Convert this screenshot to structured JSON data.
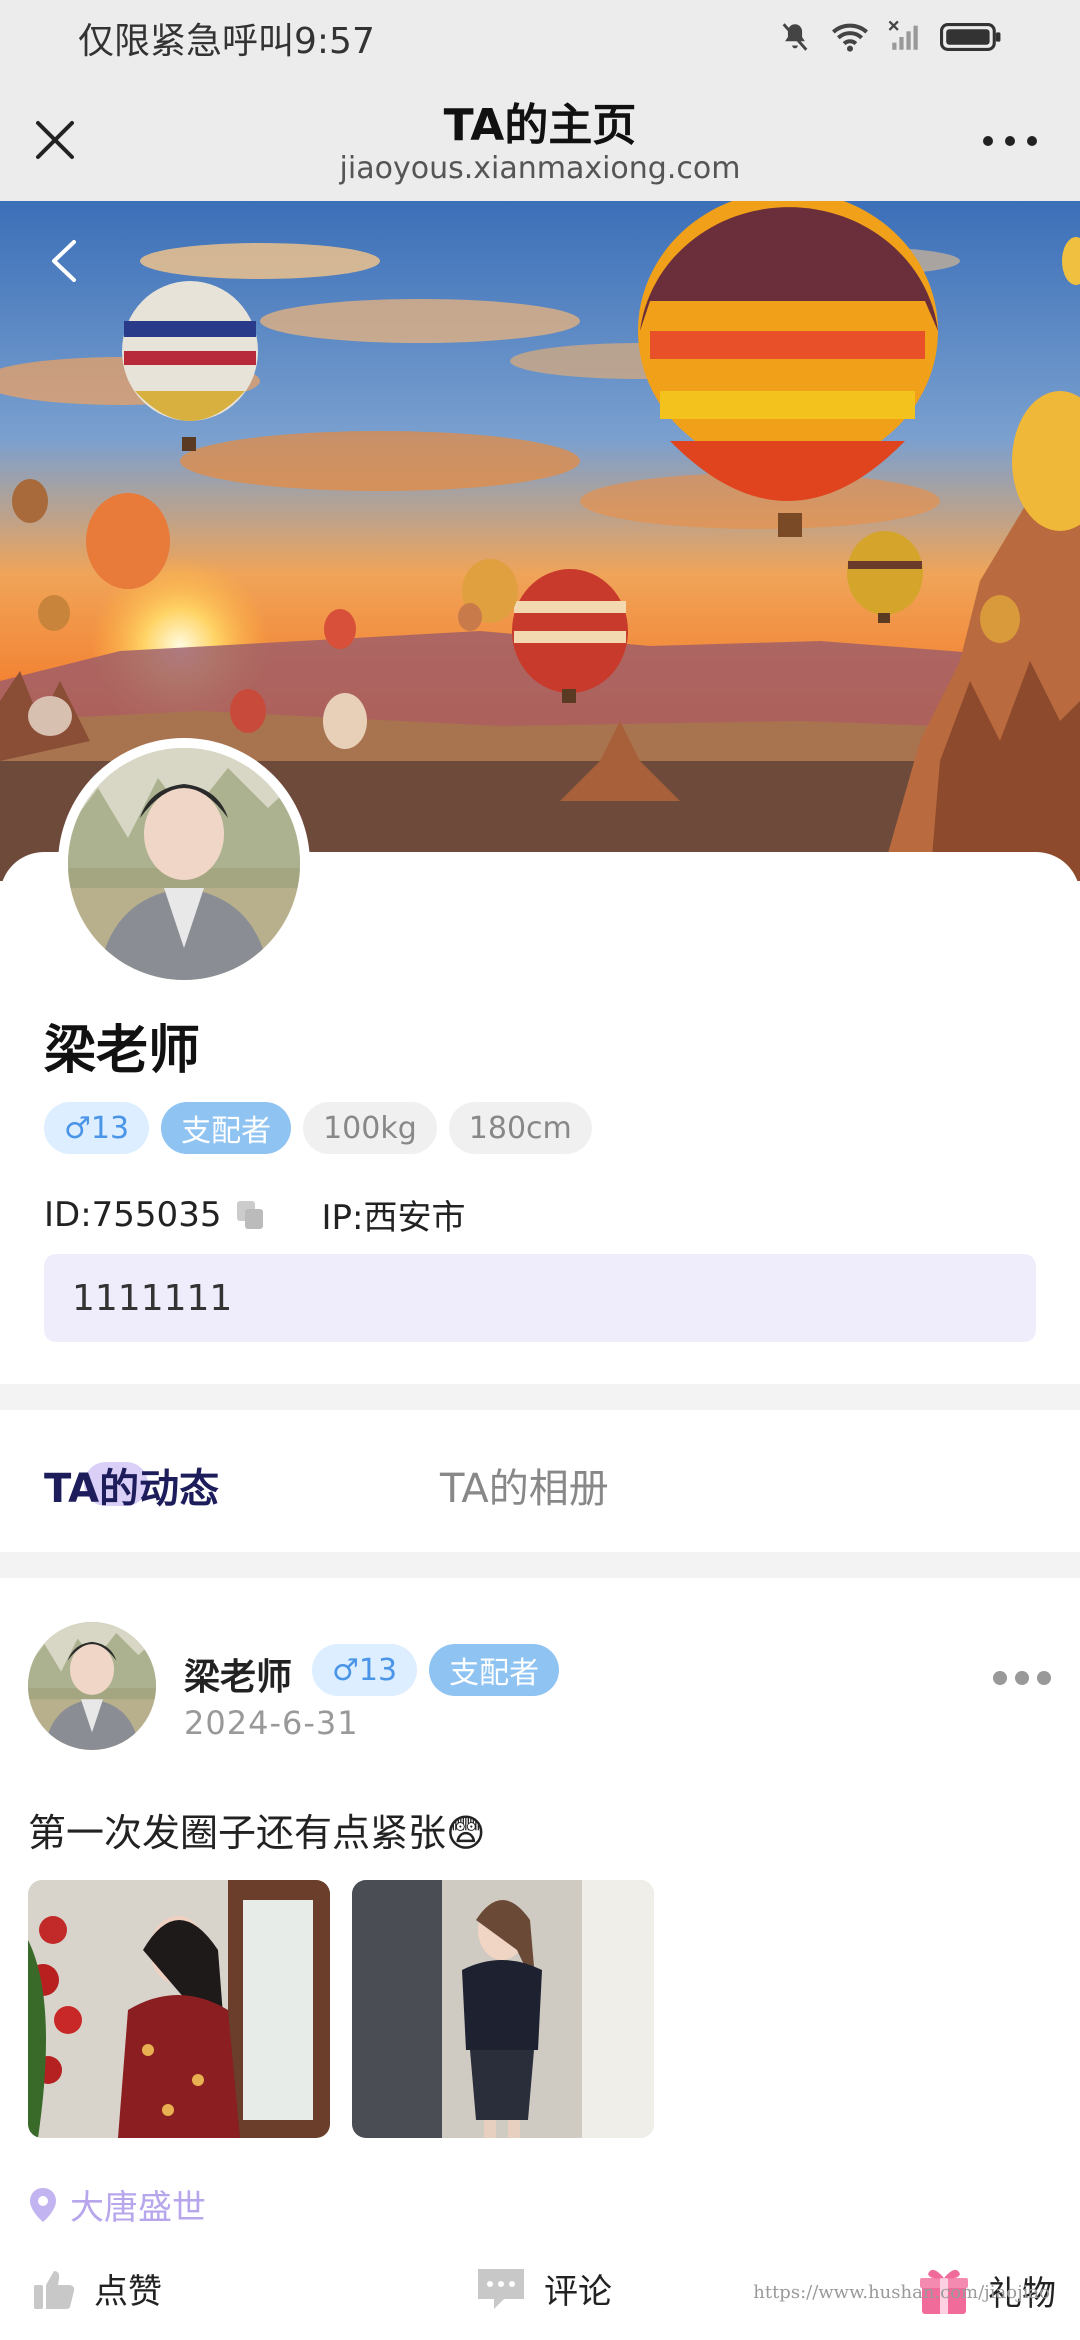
{
  "status_bar": {
    "carrier_time": "仅限紧急呼叫9:57"
  },
  "title_bar": {
    "title": "TA的主页",
    "url": "jiaoyous.xianmaxiong.com"
  },
  "profile": {
    "name": "梁老师",
    "tags": {
      "gender_age": "♂13",
      "role": "支配者",
      "weight": "100kg",
      "height": "180cm"
    },
    "id": "ID:755035",
    "ip": "IP:西安市",
    "bio": "1111111"
  },
  "tabs": {
    "active": "TA的动态",
    "inactive": "TA的相册"
  },
  "post": {
    "author": "梁老师",
    "gender_age": "♂13",
    "role": "支配者",
    "date": "2024-6-31",
    "text": "第一次发圈子还有点紧张😨",
    "location": "大唐盛世",
    "actions": {
      "like": "点赞",
      "comment": "评论",
      "gift": "礼物"
    }
  },
  "watermark": "https://www.hushan.com/jiaojiao"
}
